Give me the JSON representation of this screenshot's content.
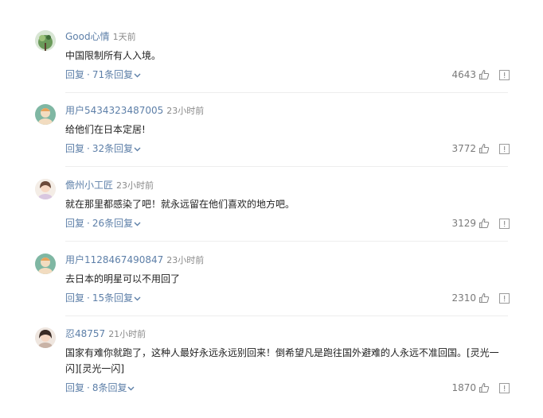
{
  "comments": [
    {
      "user": "Good心情",
      "time": "1天前",
      "text": "中国限制所有人入境。",
      "reply_label": "回复",
      "sep": "·",
      "replies_label": "71条回复",
      "likes": "4643",
      "avatar": "green-plant-avatar"
    },
    {
      "user": "用户5434323487005",
      "time": "23小时前",
      "text": "给他们在日本定居!",
      "reply_label": "回复",
      "sep": "·",
      "replies_label": "32条回复",
      "likes": "3772",
      "avatar": "default-avatar"
    },
    {
      "user": "儋州小工匠",
      "time": "23小时前",
      "text": "就在那里都感染了吧！就永远留在他们喜欢的地方吧。",
      "reply_label": "回复",
      "sep": "·",
      "replies_label": "26条回复",
      "likes": "3129",
      "avatar": "portrait-avatar"
    },
    {
      "user": "用户1128467490847",
      "time": "23小时前",
      "text": "去日本的明星可以不用回了",
      "reply_label": "回复",
      "sep": "·",
      "replies_label": "15条回复",
      "likes": "2310",
      "avatar": "default-avatar"
    },
    {
      "user": "忍48757",
      "time": "21小时前",
      "text": "国家有难你就跑了，这种人最好永远永远别回来！倒希望凡是跑往国外避难的人永远不准回国。[灵光一闪][灵光一闪]",
      "reply_label": "回复",
      "sep": "·",
      "replies_label": "8条回复",
      "likes": "1870",
      "avatar": "portrait-avatar-2"
    }
  ],
  "colors": {
    "link": "#5d7fa8",
    "text": "#222222",
    "muted": "#8a8a8a",
    "divider": "#ededed"
  }
}
